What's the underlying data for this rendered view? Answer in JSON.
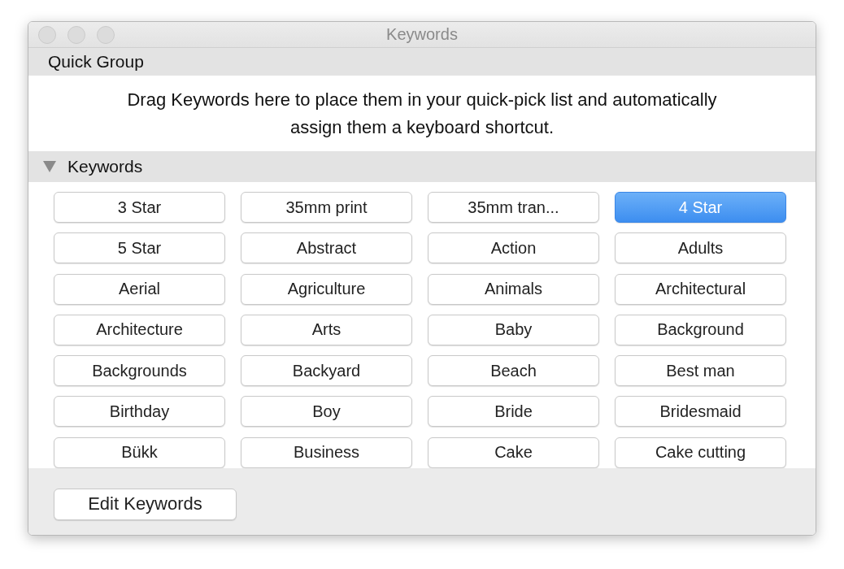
{
  "window": {
    "title": "Keywords"
  },
  "quick_group": {
    "title": "Quick Group",
    "message": "Drag Keywords here to place them in your quick-pick list and automatically assign them a keyboard shortcut."
  },
  "keywords": {
    "title": "Keywords",
    "expanded": true,
    "items": [
      {
        "label": "3 Star",
        "selected": false
      },
      {
        "label": "35mm print",
        "selected": false
      },
      {
        "label": "35mm tran...",
        "selected": false
      },
      {
        "label": "4 Star",
        "selected": true
      },
      {
        "label": "5 Star",
        "selected": false
      },
      {
        "label": "Abstract",
        "selected": false
      },
      {
        "label": "Action",
        "selected": false
      },
      {
        "label": "Adults",
        "selected": false
      },
      {
        "label": "Aerial",
        "selected": false
      },
      {
        "label": "Agriculture",
        "selected": false
      },
      {
        "label": "Animals",
        "selected": false
      },
      {
        "label": "Architectural",
        "selected": false
      },
      {
        "label": "Architecture",
        "selected": false
      },
      {
        "label": "Arts",
        "selected": false
      },
      {
        "label": "Baby",
        "selected": false
      },
      {
        "label": "Background",
        "selected": false
      },
      {
        "label": "Backgrounds",
        "selected": false
      },
      {
        "label": "Backyard",
        "selected": false
      },
      {
        "label": "Beach",
        "selected": false
      },
      {
        "label": "Best man",
        "selected": false
      },
      {
        "label": "Birthday",
        "selected": false
      },
      {
        "label": "Boy",
        "selected": false
      },
      {
        "label": "Bride",
        "selected": false
      },
      {
        "label": "Bridesmaid",
        "selected": false
      },
      {
        "label": "Bükk",
        "selected": false
      },
      {
        "label": "Business",
        "selected": false
      },
      {
        "label": "Cake",
        "selected": false
      },
      {
        "label": "Cake cutting",
        "selected": false
      }
    ]
  },
  "buttons": [
    {
      "label": "Edit Keywords"
    }
  ]
}
